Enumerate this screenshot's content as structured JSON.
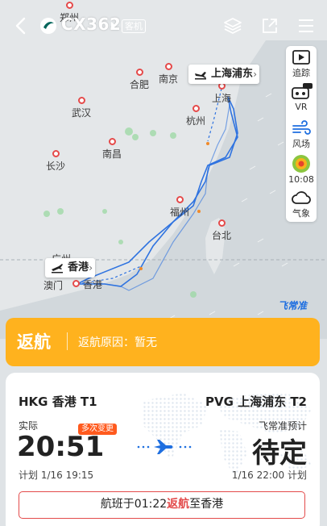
{
  "header": {
    "flight_number": "CX362",
    "aircraft_type_badge": "客机",
    "icons": [
      "back-icon",
      "airline-logo-icon",
      "layers-icon",
      "share-icon",
      "menu-icon"
    ]
  },
  "map": {
    "cities": [
      {
        "name": "郑州"
      },
      {
        "name": "合肥"
      },
      {
        "name": "南京"
      },
      {
        "name": "上海"
      },
      {
        "name": "武汉"
      },
      {
        "name": "杭州"
      },
      {
        "name": "南昌"
      },
      {
        "name": "长沙"
      },
      {
        "name": "福州"
      },
      {
        "name": "台北"
      },
      {
        "name": "广州"
      },
      {
        "name": "澳门"
      },
      {
        "name": "香港"
      }
    ],
    "destination_tag": "上海浦东",
    "origin_tag": "香港",
    "watermark": "飞常准",
    "tools": [
      {
        "label": "追踪",
        "icon": "tracking-icon"
      },
      {
        "label": "VR",
        "icon": "vr-icon",
        "badge": "PRO"
      },
      {
        "label": "风场",
        "icon": "wind-icon"
      },
      {
        "label": "10:08",
        "icon": "weather-radar-icon"
      },
      {
        "label": "气象",
        "icon": "cloud-icon"
      }
    ]
  },
  "banner": {
    "status": "返航",
    "reason": "返航原因：暂无",
    "color": "#ffb21e"
  },
  "flight": {
    "departure": {
      "airport": "HKG 香港 T1",
      "label": "实际",
      "badge": "多次变更",
      "time": "20:51",
      "scheduled": "计划 1/16 19:15"
    },
    "arrival": {
      "airport": "PVG 上海浦东 T2",
      "label": "飞常准预计",
      "time": "待定",
      "scheduled": "1/16 22:00 计划"
    },
    "notice": {
      "prefix": "航班于01:22",
      "highlight": "返航",
      "suffix": "至香港"
    },
    "accent_color": "#1f6fe0",
    "alert_color": "#e34b4b"
  }
}
